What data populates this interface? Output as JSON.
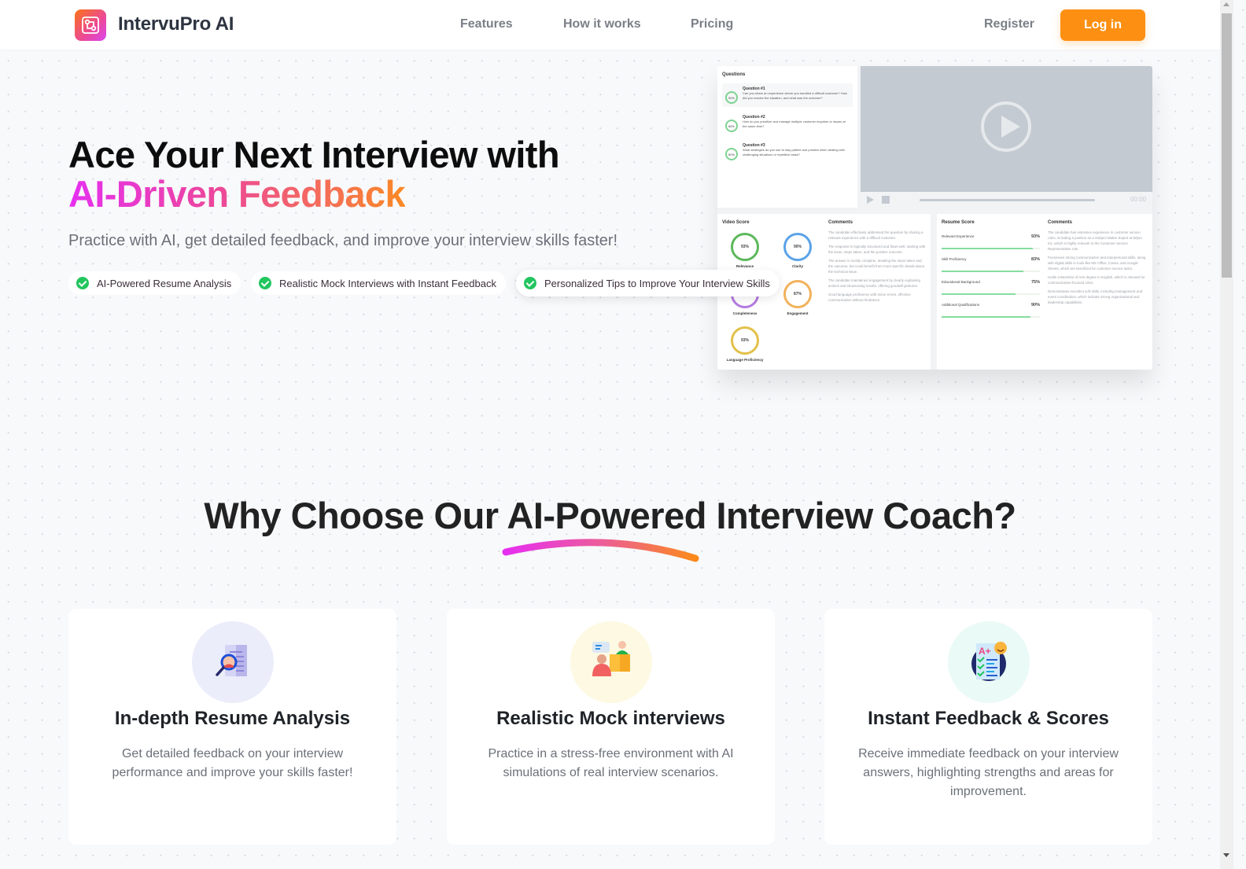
{
  "header": {
    "brand": "IntervuPro AI",
    "nav": [
      {
        "label": "Features"
      },
      {
        "label": "How it works"
      },
      {
        "label": "Pricing"
      }
    ],
    "register_label": "Register",
    "login_label": "Log in",
    "accent_color": "#fd8f12"
  },
  "hero": {
    "title_line1": "Ace Your Next Interview with",
    "title_line2": "AI-Driven Feedback",
    "subtitle": "Practice with AI, get detailed feedback, and improve your interview skills faster!",
    "pills": [
      {
        "label": "AI-Powered Resume Analysis"
      },
      {
        "label": "Realistic Mock Interviews with Instant Feedback"
      },
      {
        "label": "Personalized Tips to Improve Your Interview Skills"
      }
    ]
  },
  "mock": {
    "questions_header": "Questions",
    "questions": [
      {
        "score": "90%",
        "title": "Question #1",
        "text": "Can you share an experience where you handled a difficult customer? How did you resolve the situation, and what was the outcome?"
      },
      {
        "score": "86%",
        "title": "Question #2",
        "text": "How do you prioritize and manage multiple customer inquiries or issues at the same time?"
      },
      {
        "score": "80%",
        "title": "Question #3",
        "text": "What strategies do you use to stay patient and positive when dealing with challenging situations or repetitive tasks?"
      }
    ],
    "video_time": "00:00",
    "video_score_header": "Video Score",
    "video_scores": [
      {
        "label": "Relevance",
        "value": "93%",
        "color": "#5cb85c"
      },
      {
        "label": "Clarity",
        "value": "90%",
        "color": "#5aa3e8"
      },
      {
        "label": "Completeness",
        "value": "88%",
        "color": "#b57be0"
      },
      {
        "label": "Engagement",
        "value": "87%",
        "color": "#f2b25c"
      },
      {
        "label": "Language Proficiency",
        "value": "93%",
        "color": "#e3c04a"
      }
    ],
    "comments_header": "Comments",
    "video_comments": [
      "The candidate effectively addressed the question by sharing a relevant experience with a difficult customer.",
      "The response is logically structured and flows well, starting with the issue, steps taken, and the positive outcome.",
      "The answer is mostly complete, detailing the steps taken and the outcome, but could benefit from more specific details about the technical issue.",
      "The candidate maintained engagement by clearly explaining actions and showcasing results, offering goodwill gestures.",
      "Good language proficiency with minor errors, effective communication without hindrance."
    ],
    "resume_score_header": "Resume Score",
    "resume_scores": [
      {
        "label": "Relevant Experience",
        "value": "93%",
        "fraction": 0.93
      },
      {
        "label": "Skill Proficiency",
        "value": "83%",
        "fraction": 0.83
      },
      {
        "label": "Educational Background",
        "value": "75%",
        "fraction": 0.75
      },
      {
        "label": "Additional Qualifications",
        "value": "90%",
        "fraction": 0.9
      }
    ],
    "resume_comments": [
      "The candidate has extensive experience in customer service roles, including a position as a Subject Matter Expert at Wipro Inc, which is highly relevant to the Customer Service Representative role.",
      "Possesses strong communication and interpersonal skills, along with digital skills in tools like MS Office, Canva, and Google Sheets, which are beneficial for customer service tasks.",
      "Holds a Bachelor of Arts degree in English, which is relevant for communication-focused roles.",
      "Demonstrates excellent soft skills, including management and event coordination, which indicate strong organizational and leadership capabilities."
    ]
  },
  "why": {
    "title": "Why Choose Our AI-Powered Interview Coach?",
    "cards": [
      {
        "icon": "resume-search-icon",
        "title": "In-depth Resume Analysis",
        "text": "Get detailed feedback on your interview performance and improve your skills faster!"
      },
      {
        "icon": "mock-interview-icon",
        "title": "Realistic Mock interviews",
        "text": "Practice in a stress-free environment with AI simulations of real interview scenarios."
      },
      {
        "icon": "feedback-scores-icon",
        "title": "Instant Feedback & Scores",
        "text": "Receive immediate feedback on your interview answers, highlighting strengths and areas for improvement."
      }
    ]
  }
}
